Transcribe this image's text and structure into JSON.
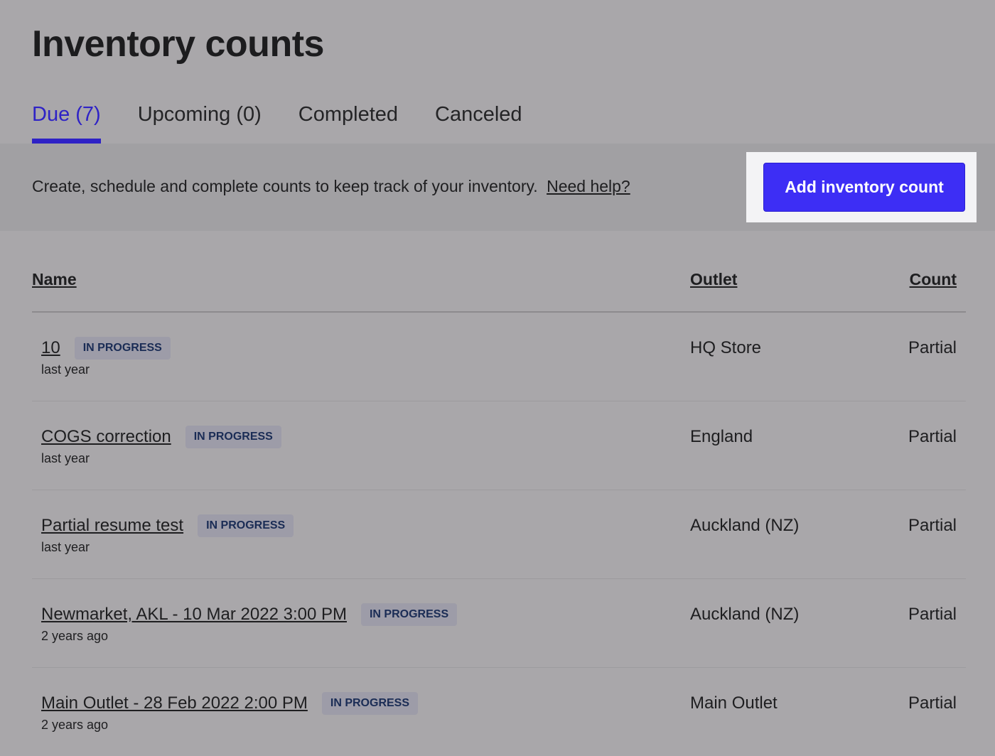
{
  "page": {
    "title": "Inventory counts"
  },
  "tabs": [
    {
      "label": "Due (7)",
      "active": true
    },
    {
      "label": "Upcoming (0)",
      "active": false
    },
    {
      "label": "Completed",
      "active": false
    },
    {
      "label": "Canceled",
      "active": false
    }
  ],
  "banner": {
    "text": "Create, schedule and complete counts to keep track of your inventory.",
    "help_link": "Need help?",
    "add_button": "Add inventory count"
  },
  "table": {
    "headers": {
      "name": "Name",
      "outlet": "Outlet",
      "count": "Count"
    },
    "rows": [
      {
        "name": "10",
        "status": "IN PROGRESS",
        "when": "last year",
        "outlet": "HQ Store",
        "count": "Partial"
      },
      {
        "name": "COGS correction",
        "status": "IN PROGRESS",
        "when": "last year",
        "outlet": "England",
        "count": "Partial"
      },
      {
        "name": "Partial resume test",
        "status": "IN PROGRESS",
        "when": "last year",
        "outlet": "Auckland (NZ)",
        "count": "Partial"
      },
      {
        "name": "Newmarket, AKL - 10 Mar 2022 3:00 PM",
        "status": "IN PROGRESS",
        "when": "2 years ago",
        "outlet": "Auckland (NZ)",
        "count": "Partial"
      },
      {
        "name": "Main Outlet - 28 Feb 2022 2:00 PM",
        "status": "IN PROGRESS",
        "when": "2 years ago",
        "outlet": "Main Outlet",
        "count": "Partial"
      }
    ]
  },
  "colors": {
    "accent": "#3d2ef5",
    "tab_active": "#2e22c6",
    "badge_text": "#1a2c55"
  }
}
